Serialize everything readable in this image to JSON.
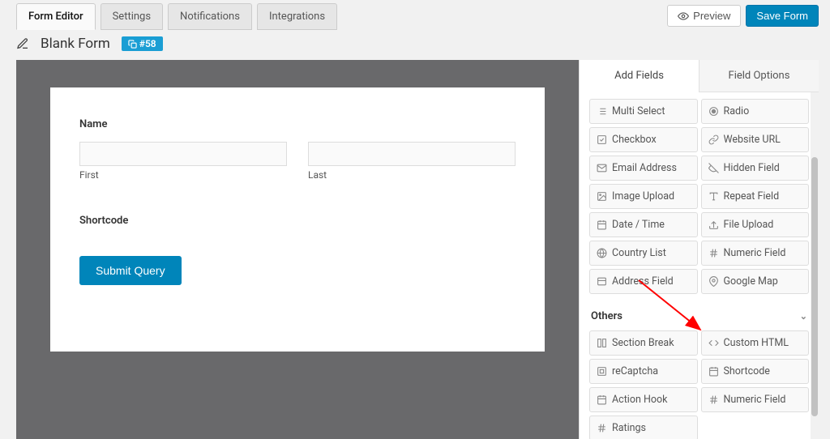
{
  "tabs": {
    "form_editor": "Form Editor",
    "settings": "Settings",
    "notifications": "Notifications",
    "integrations": "Integrations"
  },
  "actions": {
    "preview": "Preview",
    "save": "Save Form"
  },
  "form": {
    "title": "Blank Form",
    "id_badge": "#58",
    "name_label": "Name",
    "first_sub": "First",
    "last_sub": "Last",
    "shortcode_label": "Shortcode",
    "submit_label": "Submit Query"
  },
  "side_tabs": {
    "add_fields": "Add Fields",
    "field_options": "Field Options"
  },
  "fields": [
    {
      "icon": "list",
      "label": "Multi Select"
    },
    {
      "icon": "dot",
      "label": "Radio"
    },
    {
      "icon": "check",
      "label": "Checkbox"
    },
    {
      "icon": "link",
      "label": "Website URL"
    },
    {
      "icon": "mail",
      "label": "Email Address"
    },
    {
      "icon": "eyeoff",
      "label": "Hidden Field"
    },
    {
      "icon": "image",
      "label": "Image Upload"
    },
    {
      "icon": "repeat",
      "label": "Repeat Field"
    },
    {
      "icon": "calendar",
      "label": "Date / Time"
    },
    {
      "icon": "upload",
      "label": "File Upload"
    },
    {
      "icon": "globe",
      "label": "Country List"
    },
    {
      "icon": "hash",
      "label": "Numeric Field"
    },
    {
      "icon": "card",
      "label": "Address Field"
    },
    {
      "icon": "pin",
      "label": "Google Map"
    }
  ],
  "others_title": "Others",
  "others": [
    {
      "icon": "columns",
      "label": "Section Break"
    },
    {
      "icon": "code",
      "label": "Custom HTML"
    },
    {
      "icon": "rec",
      "label": "reCaptcha"
    },
    {
      "icon": "calendar",
      "label": "Shortcode"
    },
    {
      "icon": "calendar",
      "label": "Action Hook"
    },
    {
      "icon": "hash",
      "label": "Numeric Field"
    },
    {
      "icon": "hash",
      "label": "Ratings"
    }
  ]
}
